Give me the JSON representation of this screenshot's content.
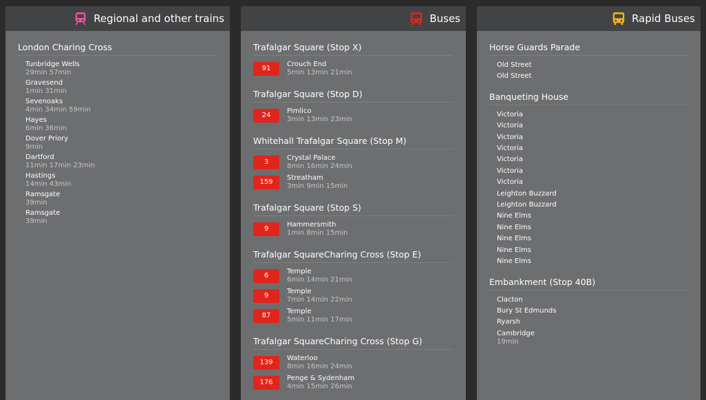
{
  "panels": {
    "trains": {
      "title": "Regional and other trains",
      "icon": "train-icon",
      "icon_color": "#e8549a",
      "stop": {
        "name": "London Charing Cross",
        "departures": [
          {
            "dest": "Tunbridge Wells",
            "times": "29min 57min"
          },
          {
            "dest": "Gravesend",
            "times": "1min 31min"
          },
          {
            "dest": "Sevenoaks",
            "times": "4min 34min 59min"
          },
          {
            "dest": "Hayes",
            "times": "6min 36min"
          },
          {
            "dest": "Dover Priory",
            "times": "9min"
          },
          {
            "dest": "Dartford",
            "times": "11min 17min 23min"
          },
          {
            "dest": "Hastings",
            "times": "14min 43min"
          },
          {
            "dest": "Ramsgate",
            "times": "39min"
          },
          {
            "dest": "Ramsgate",
            "times": "39min"
          }
        ]
      }
    },
    "buses": {
      "title": "Buses",
      "icon": "bus-icon",
      "icon_color": "#e1251b",
      "stops": [
        {
          "name": "Trafalgar Square (Stop X)",
          "departures": [
            {
              "route": "91",
              "dest": "Crouch End",
              "times": "5min 13min 21min"
            }
          ]
        },
        {
          "name": "Trafalgar Square (Stop D)",
          "departures": [
            {
              "route": "24",
              "dest": "Pimlico",
              "times": "3min 13min 23min"
            }
          ]
        },
        {
          "name": "Whitehall Trafalgar Square (Stop M)",
          "departures": [
            {
              "route": "3",
              "dest": "Crystal Palace",
              "times": "8min 16min 24min"
            },
            {
              "route": "159",
              "dest": "Streatham",
              "times": "3min 9min 15min"
            }
          ]
        },
        {
          "name": "Trafalgar Square (Stop S)",
          "departures": [
            {
              "route": "9",
              "dest": "Hammersmith",
              "times": "1min 8min 15min"
            }
          ]
        },
        {
          "name": "Trafalgar SquareCharing Cross (Stop E)",
          "departures": [
            {
              "route": "6",
              "dest": "Temple",
              "times": "6min 14min 21min"
            },
            {
              "route": "9",
              "dest": "Temple",
              "times": "7min 14min 22min"
            },
            {
              "route": "87",
              "dest": "Temple",
              "times": "5min 11min 17min"
            }
          ]
        },
        {
          "name": "Trafalgar SquareCharing Cross (Stop G)",
          "departures": [
            {
              "route": "139",
              "dest": "Waterloo",
              "times": "8min 16min 24min"
            },
            {
              "route": "176",
              "dest": "Penge & Sydenham",
              "times": "4min 15min 26min"
            }
          ]
        }
      ]
    },
    "rapid": {
      "title": "Rapid Buses",
      "icon": "rapid-bus-icon",
      "icon_color": "#f5b21b",
      "stops": [
        {
          "name": "Horse Guards Parade",
          "departures": [
            {
              "dest": "Old Street",
              "times": ""
            },
            {
              "dest": "Old Street",
              "times": ""
            }
          ]
        },
        {
          "name": "Banqueting House",
          "departures": [
            {
              "dest": "Victoria",
              "times": ""
            },
            {
              "dest": "Victoria",
              "times": ""
            },
            {
              "dest": "Victoria",
              "times": ""
            },
            {
              "dest": "Victoria",
              "times": ""
            },
            {
              "dest": "Victoria",
              "times": ""
            },
            {
              "dest": "Victoria",
              "times": ""
            },
            {
              "dest": "Victoria",
              "times": ""
            },
            {
              "dest": "Leighton Buzzard",
              "times": ""
            },
            {
              "dest": "Leighton Buzzard",
              "times": ""
            },
            {
              "dest": "Nine Elms",
              "times": ""
            },
            {
              "dest": "Nine Elms",
              "times": ""
            },
            {
              "dest": "Nine Elms",
              "times": ""
            },
            {
              "dest": "Nine Elms",
              "times": ""
            },
            {
              "dest": "Nine Elms",
              "times": ""
            }
          ]
        },
        {
          "name": "Embankment (Stop 40B)",
          "departures": [
            {
              "dest": "Clacton",
              "times": ""
            },
            {
              "dest": "Bury St Edmunds",
              "times": ""
            },
            {
              "dest": "Ryarsh",
              "times": ""
            },
            {
              "dest": "Cambridge",
              "times": "19min"
            }
          ]
        }
      ]
    }
  }
}
